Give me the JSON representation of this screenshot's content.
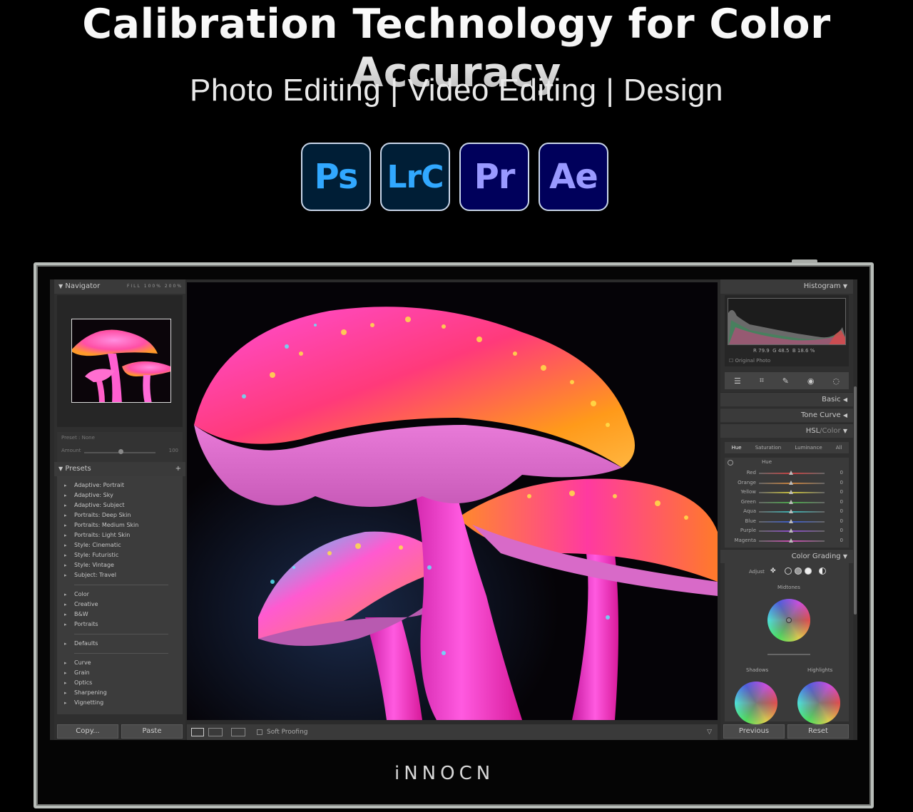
{
  "headline": "Calibration Technology for Color Accuracy",
  "subhead": "Photo Editing | Video Editing | Design",
  "app_icons": [
    {
      "label": "Ps",
      "icon": "photoshop-icon"
    },
    {
      "label": "LrC",
      "icon": "lightroom-classic-icon"
    },
    {
      "label": "Pr",
      "icon": "premiere-pro-icon"
    },
    {
      "label": "Ae",
      "icon": "after-effects-icon"
    }
  ],
  "brand": "iNNOCN",
  "colors": {
    "background": "#000000",
    "ps_blue": "#31a8ff",
    "pr_purple": "#9999ff",
    "panel": "#2f2f2f"
  },
  "lightroom": {
    "left": {
      "navigator_title": "Navigator",
      "zoom_options": [
        "FILL",
        "100%",
        "200%"
      ],
      "preset_label": "Preset : None",
      "amount_label": "Amount",
      "amount_value": "100",
      "presets_title": "Presets",
      "presets_add": "+",
      "preset_groups": [
        [
          "Adaptive: Portrait",
          "Adaptive: Sky",
          "Adaptive: Subject",
          "Portraits: Deep Skin",
          "Portraits: Medium Skin",
          "Portraits: Light Skin",
          "Style: Cinematic",
          "Style: Futuristic",
          "Style: Vintage",
          "Subject: Travel"
        ],
        [
          "Color",
          "Creative",
          "B&W",
          "Portraits"
        ],
        [
          "Defaults"
        ],
        [
          "Curve",
          "Grain",
          "Optics",
          "Sharpening",
          "Vignetting"
        ]
      ],
      "copy_button": "Copy...",
      "paste_button": "Paste"
    },
    "toolbar": {
      "soft_proofing": "Soft Proofing"
    },
    "right": {
      "histogram_title": "Histogram",
      "rgb_readout": {
        "r_label": "R",
        "r": "79.9",
        "g_label": "G",
        "g": "48.5",
        "b_label": "B",
        "b": "18.6",
        "unit": "%"
      },
      "original_photo": "Original Photo",
      "sections": {
        "basic": "Basic",
        "tone_curve": "Tone Curve",
        "hsl": "HSL",
        "hsl_sep": "/",
        "color": "Color",
        "color_grading": "Color Grading"
      },
      "hsl_tabs": [
        "Hue",
        "Saturation",
        "Luminance",
        "All"
      ],
      "hsl_subtitle": "Hue",
      "hsl_rows": [
        {
          "name": "Red",
          "value": "0",
          "color": "#c84040"
        },
        {
          "name": "Orange",
          "value": "0",
          "color": "#c8803a"
        },
        {
          "name": "Yellow",
          "value": "0",
          "color": "#c8c03a"
        },
        {
          "name": "Green",
          "value": "0",
          "color": "#4aa84a"
        },
        {
          "name": "Aqua",
          "value": "0",
          "color": "#3ab0b0"
        },
        {
          "name": "Blue",
          "value": "0",
          "color": "#3a5ac8"
        },
        {
          "name": "Purple",
          "value": "0",
          "color": "#8a4ac8"
        },
        {
          "name": "Magenta",
          "value": "0",
          "color": "#c84ab0"
        }
      ],
      "color_grading": {
        "adjust_label": "Adjust",
        "midtones": "Midtones",
        "shadows": "Shadows",
        "highlights": "Highlights"
      },
      "previous_button": "Previous",
      "reset_button": "Reset"
    }
  }
}
